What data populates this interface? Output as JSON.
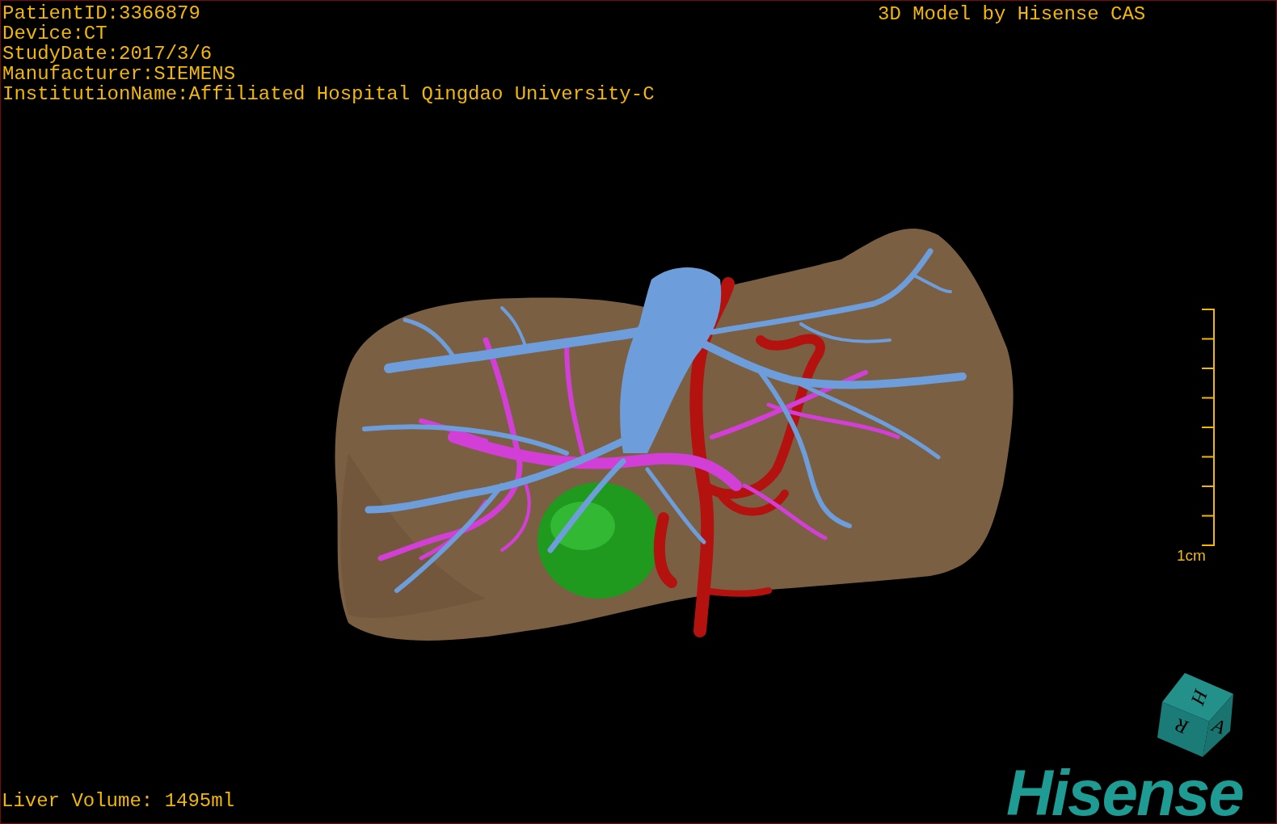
{
  "info_lines": [
    "PatientID:3366879",
    "Device:CT",
    "StudyDate:2017/3/6",
    "Manufacturer:SIEMENS",
    "InstitutionName:Affiliated Hospital Qingdao University-C"
  ],
  "model_credit": "3D Model by Hisense CAS",
  "scale": {
    "label": "1cm"
  },
  "liver_volume": "Liver Volume: 1495ml",
  "orientation_cube": {
    "labels": [
      "H",
      "R",
      "A"
    ]
  },
  "logo": "Hisense"
}
